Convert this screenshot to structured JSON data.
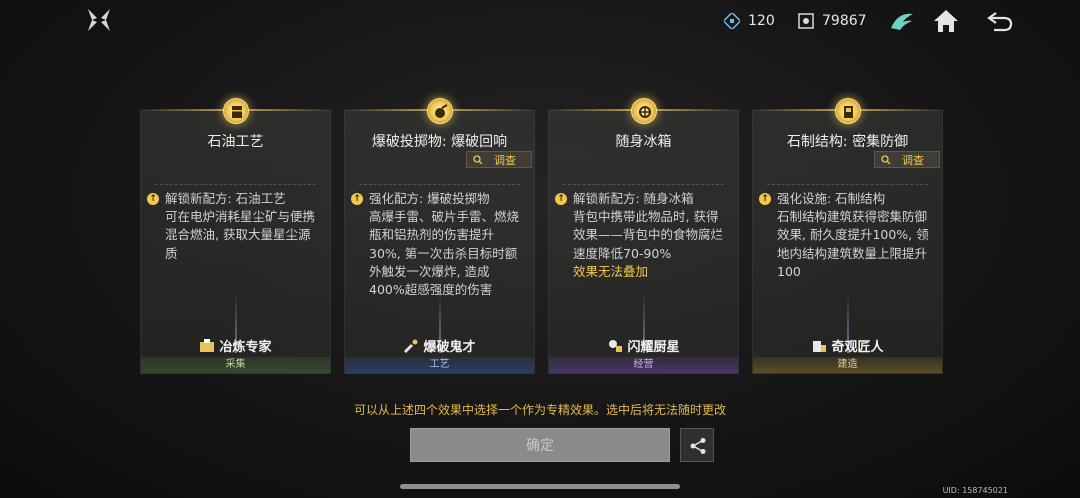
{
  "resources": [
    {
      "icon": "energy-crystal-icon",
      "value": "120"
    },
    {
      "icon": "coin-icon",
      "value": "79867"
    }
  ],
  "cards": [
    {
      "icon": "oil-barrel-icon",
      "title": "石油工艺",
      "has_probe": false,
      "bullet": "↑",
      "desc_head": "解锁新配方: 石油工艺",
      "desc_body": "可在电炉消耗星尘矿与便携混合燃油, 获取大量星尘源质",
      "desc_note": "",
      "skill_icon": "smelt-icon",
      "skill": "冶炼专家",
      "category": "采集"
    },
    {
      "icon": "grenade-icon",
      "title": "爆破投掷物: 爆破回响",
      "has_probe": true,
      "probe_label": "调查",
      "bullet": "↑",
      "desc_head": "强化配方: 爆破投掷物",
      "desc_body": "高爆手雷、破片手雷、燃烧瓶和铝热剂的伤害提升30%, 第一次击杀目标时额外触发一次爆炸, 造成400%超感强度的伤害",
      "desc_note": "",
      "skill_icon": "blast-icon",
      "skill": "爆破鬼才",
      "category": "工艺"
    },
    {
      "icon": "cooler-icon",
      "title": "随身冰箱",
      "has_probe": false,
      "bullet": "↑",
      "desc_head": "解锁新配方: 随身冰箱",
      "desc_body": "背包中携带此物品时, 获得效果——背包中的食物腐烂速度降低70-90%",
      "desc_note": "效果无法叠加",
      "skill_icon": "chef-icon",
      "skill": "闪耀厨星",
      "category": "经营"
    },
    {
      "icon": "structure-icon",
      "title": "石制结构: 密集防御",
      "has_probe": true,
      "probe_label": "调查",
      "bullet": "↑",
      "desc_head": "强化设施: 石制结构",
      "desc_body": "石制结构建筑获得密集防御效果, 耐久度提升100%, 领地内结构建筑数量上限提升100",
      "desc_note": "",
      "skill_icon": "builder-icon",
      "skill": "奇观匠人",
      "category": "建造"
    }
  ],
  "notice": "可以从上述四个效果中选择一个作为专精效果。选中后将无法随时更改",
  "confirm_label": "确定",
  "uid": "UID: 158745021",
  "colors": {
    "accent": "#f2c84b",
    "confirm_disabled": "#8a8a8a"
  }
}
